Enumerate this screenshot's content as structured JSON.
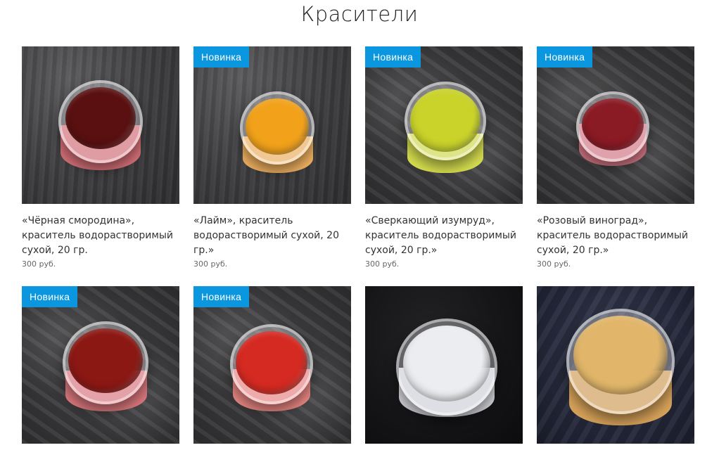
{
  "page": {
    "title": "Красители"
  },
  "products": [
    {
      "name": "«Чёрная смородина», краситель водорастворимый сухой, 20 гр.",
      "price": "300 руб.",
      "badge": "",
      "powder_color": "#5a1010",
      "base_color": "#d9727a"
    },
    {
      "name": "«Лайм», краситель водорастворимый сухой, 20 гр.»",
      "price": "300 руб.",
      "badge": "Новинка",
      "powder_color": "#f2a21a",
      "base_color": "#f5b562"
    },
    {
      "name": "«Сверкающий изумруд», краситель водорастворимый сухой, 20 гр.»",
      "price": "300 руб.",
      "badge": "Новинка",
      "powder_color": "#c9d32a",
      "base_color": "#d8e050"
    },
    {
      "name": "«Розовый виноград», краситель водорастворимый сухой, 20 гр.»",
      "price": "300 руб.",
      "badge": "Новинка",
      "powder_color": "#8a1a24",
      "base_color": "#d97a88"
    },
    {
      "name": "",
      "price": "",
      "badge": "Новинка",
      "powder_color": "#8c1814",
      "base_color": "#e07a80"
    },
    {
      "name": "",
      "price": "",
      "badge": "Новинка",
      "powder_color": "#d52a22",
      "base_color": "#ef8a86"
    },
    {
      "name": "",
      "price": "",
      "badge": "",
      "powder_color": "#ecedf0",
      "base_color": "#d8d9de"
    },
    {
      "name": "",
      "price": "",
      "badge": "",
      "powder_color": "#e1b66a",
      "base_color": "#d9a45a"
    }
  ],
  "colors": {
    "badge_bg": "#0a97df",
    "text": "#333333",
    "price": "#666666"
  }
}
